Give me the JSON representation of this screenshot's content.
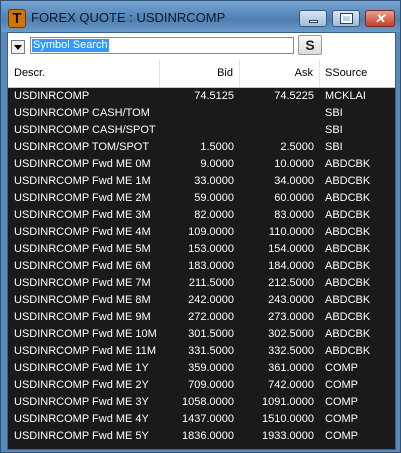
{
  "window": {
    "title": "FOREX QUOTE : USDINRCOMP",
    "app_icon_letter": "T",
    "close_glyph": "✕"
  },
  "toolbar": {
    "search_value": "Symbol Search",
    "link_glyph": "S"
  },
  "table": {
    "columns": [
      "Descr.",
      "Bid",
      "Ask",
      "SSource"
    ],
    "rows": [
      [
        "USDINRCOMP",
        "74.5125",
        "74.5225",
        "MCKLAI"
      ],
      [
        "USDINRCOMP CASH/TOM",
        "",
        "",
        "SBI"
      ],
      [
        "USDINRCOMP CASH/SPOT",
        "",
        "",
        "SBI"
      ],
      [
        "USDINRCOMP TOM/SPOT",
        "1.5000",
        "2.5000",
        "SBI"
      ],
      [
        "USDINRCOMP Fwd ME 0M",
        "9.0000",
        "10.0000",
        "ABDCBK"
      ],
      [
        "USDINRCOMP Fwd ME 1M",
        "33.0000",
        "34.0000",
        "ABDCBK"
      ],
      [
        "USDINRCOMP Fwd ME 2M",
        "59.0000",
        "60.0000",
        "ABDCBK"
      ],
      [
        "USDINRCOMP Fwd ME 3M",
        "82.0000",
        "83.0000",
        "ABDCBK"
      ],
      [
        "USDINRCOMP Fwd ME 4M",
        "109.0000",
        "110.0000",
        "ABDCBK"
      ],
      [
        "USDINRCOMP Fwd ME 5M",
        "153.0000",
        "154.0000",
        "ABDCBK"
      ],
      [
        "USDINRCOMP Fwd ME 6M",
        "183.0000",
        "184.0000",
        "ABDCBK"
      ],
      [
        "USDINRCOMP Fwd ME 7M",
        "211.5000",
        "212.5000",
        "ABDCBK"
      ],
      [
        "USDINRCOMP Fwd ME 8M",
        "242.0000",
        "243.0000",
        "ABDCBK"
      ],
      [
        "USDINRCOMP Fwd ME 9M",
        "272.0000",
        "273.0000",
        "ABDCBK"
      ],
      [
        "USDINRCOMP Fwd ME 10M",
        "301.5000",
        "302.5000",
        "ABDCBK"
      ],
      [
        "USDINRCOMP Fwd ME 11M",
        "331.5000",
        "332.5000",
        "ABDCBK"
      ],
      [
        "USDINRCOMP Fwd ME 1Y",
        "359.0000",
        "361.0000",
        "COMP"
      ],
      [
        "USDINRCOMP Fwd ME 2Y",
        "709.0000",
        "742.0000",
        "COMP"
      ],
      [
        "USDINRCOMP Fwd ME 3Y",
        "1058.0000",
        "1091.0000",
        "COMP"
      ],
      [
        "USDINRCOMP Fwd ME 4Y",
        "1437.0000",
        "1510.0000",
        "COMP"
      ],
      [
        "USDINRCOMP Fwd ME 5Y",
        "1836.0000",
        "1933.0000",
        "COMP"
      ]
    ]
  }
}
